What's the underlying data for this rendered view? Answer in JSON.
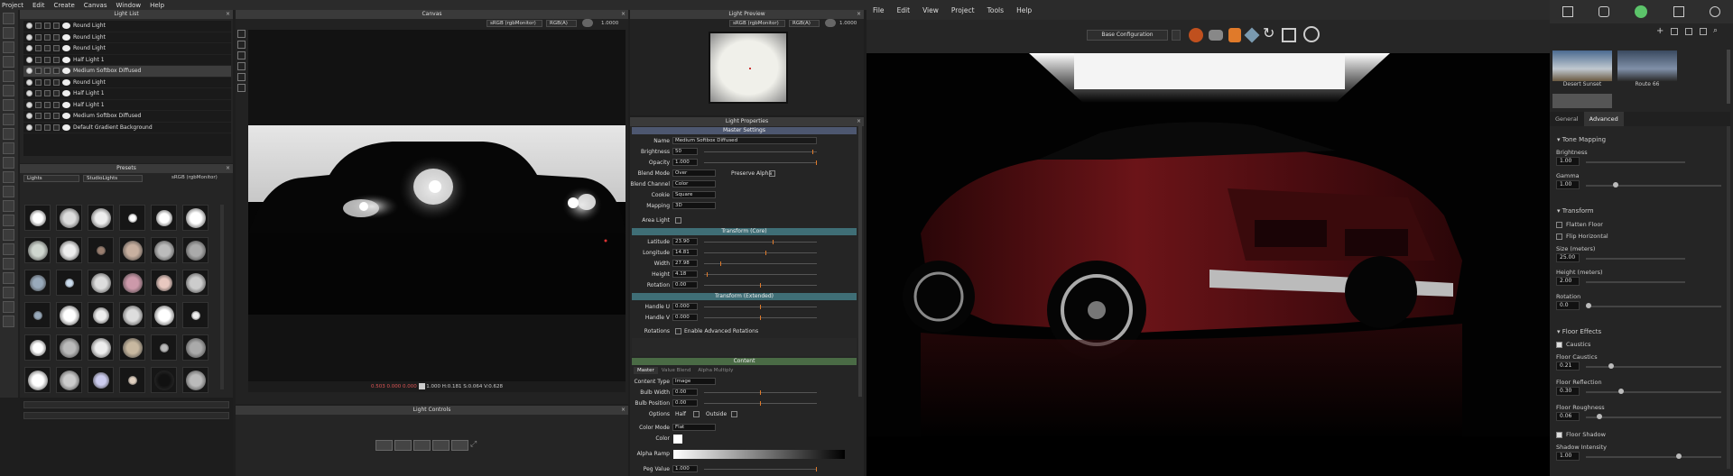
{
  "left_menu": [
    "Project",
    "Edit",
    "Create",
    "Canvas",
    "Window",
    "Help"
  ],
  "right_menu": [
    "File",
    "Edit",
    "View",
    "Project",
    "Tools",
    "Help"
  ],
  "light_list": {
    "title": "Light List",
    "items": [
      "Round Light",
      "Round Light",
      "Round Light",
      "Half Light 1",
      "Medium Softbox Diffused",
      "Round Light",
      "Half Light 1",
      "Half Light 1",
      "Medium Softbox Diffused",
      "Default Gradient Background"
    ],
    "selected": 4
  },
  "canvas": {
    "title": "Canvas",
    "color_space": "sRGB (rgbMonitor)",
    "channel": "RGB(A)",
    "exposure": "1.0000",
    "status_rgb": "0.503  0.000  0.000",
    "status_extra": "1.000",
    "status_hv": "H:0.181 S:0.064 V:0.628"
  },
  "light_preview": {
    "title": "Light Preview",
    "color_space": "sRGB (rgbMonitor)",
    "channel": "RGB(A)",
    "exposure": "1.0000"
  },
  "presets": {
    "title": "Presets",
    "filter1": "Lights",
    "filter2": "StudioLights",
    "color_space": "sRGB (rgbMonitor)"
  },
  "light_controls": {
    "title": "Light Controls"
  },
  "props": {
    "title": "Light Properties",
    "master": "Master Settings",
    "name_label": "Name",
    "name": "Medium Softbox Diffused",
    "brightness_label": "Brightness",
    "brightness": "50",
    "opacity_label": "Opacity",
    "opacity": "1.000",
    "blend_label": "Blend Mode",
    "blend": "Over",
    "preserve_alpha": "Preserve Alpha",
    "channel_label": "Blend Channel",
    "channel": "Color",
    "cookie_label": "Cookie",
    "cookie": "Square",
    "mapping_label": "Mapping",
    "mapping": "3D",
    "area_label": "Area Light",
    "tcore": "Transform (Core)",
    "lat_label": "Latitude",
    "lat": "23.90",
    "lon_label": "Longitude",
    "lon": "14.81",
    "w_label": "Width",
    "w": "27.98",
    "h_label": "Height",
    "h": "4.18",
    "rot_label": "Rotation",
    "rot": "0.00",
    "text": "Transform (Extended)",
    "hu_label": "Handle U",
    "hu": "0.000",
    "hv_label": "Handle V",
    "hv": "0.000",
    "rots_label": "Rotations",
    "rots": "Enable Advanced Rotations",
    "content": "Content",
    "tabs": [
      "Master",
      "Value Blend",
      "Alpha Multiply"
    ],
    "ctype_label": "Content Type",
    "ctype": "Image",
    "bw_label": "Bulb Width",
    "bw": "0.00",
    "bp_label": "Bulb Position",
    "bp": "0.00",
    "opt_label": "Options",
    "opt_half": "Half",
    "opt_outside": "Outside",
    "cmode_label": "Color Mode",
    "cmode": "Flat",
    "color_label": "Color",
    "aramp_label": "Alpha Ramp",
    "peg_label": "Peg Value",
    "peg": "1.000"
  },
  "viewer": {
    "config": "Base Configuration"
  },
  "env": {
    "names": [
      "Desert Sunset",
      "Route 66"
    ],
    "tabs": [
      "General",
      "Advanced"
    ]
  },
  "tone": {
    "title": "Tone Mapping",
    "bright_label": "Brightness",
    "bright": "1.00",
    "gamma_label": "Gamma",
    "gamma": "1.00"
  },
  "transform": {
    "title": "Transform",
    "flatten": "Flatten Floor",
    "flip": "Flip Horizontal",
    "size_label": "Size (meters)",
    "size": "25.00",
    "height_label": "Height (meters)",
    "height": "2.00",
    "rot_label": "Rotation",
    "rot": "0.0"
  },
  "floor": {
    "title": "Floor Effects",
    "caustics": "Caustics",
    "fc_label": "Floor Caustics",
    "fc": "0.21",
    "fr_label": "Floor Reflection",
    "fr": "0.30",
    "frough_label": "Floor Roughness",
    "frough": "0.06",
    "shadow": "Floor Shadow",
    "si_label": "Shadow Intensity",
    "si": "1.00"
  }
}
